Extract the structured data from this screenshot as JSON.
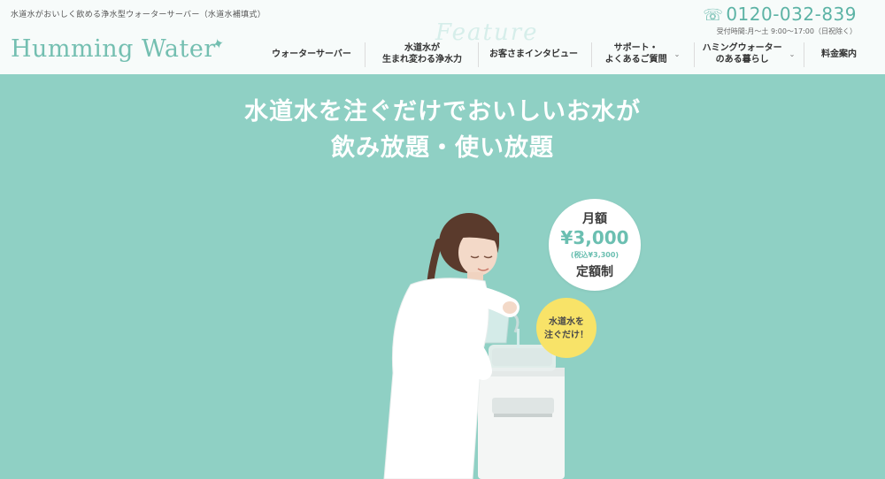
{
  "header": {
    "tagline": "水道水がおいしく飲める浄水型ウォーターサーバー（水道水補填式）",
    "logo": "Humming Water",
    "feature_word": "Feature",
    "phone": "0120-032-839",
    "hours": "受付時間:月〜土 9:00〜17:00（日祝除く）"
  },
  "nav": {
    "items": [
      {
        "line1": "ウォーターサーバー",
        "line2": ""
      },
      {
        "line1": "水道水が",
        "line2": "生まれ変わる浄水力"
      },
      {
        "line1": "お客さまインタビュー",
        "line2": ""
      },
      {
        "line1": "サポート・",
        "line2": "よくあるご質問"
      },
      {
        "line1": "ハミングウォーター",
        "line2": "のある暮らし"
      },
      {
        "line1": "料金案内",
        "line2": ""
      }
    ]
  },
  "hero": {
    "headline1": "水道水を注ぐだけでおいしいお水が",
    "headline2": "飲み放題・使い放題",
    "price_badge": {
      "label_top": "月額",
      "price": "¥3,000",
      "tax": "(税込¥3,300)",
      "label_bottom": "定額制"
    },
    "pour_badge": {
      "line1": "水道水を",
      "line2": "注ぐだけ！"
    }
  },
  "icons": {
    "phone": "phone-icon",
    "logo_mark": "bird-icon",
    "dropdown": "chevron-down-icon"
  },
  "colors": {
    "brand": "#74bfb1",
    "hero_bg": "#8fd0c4",
    "header_bg": "#f7fbfa",
    "badge_yellow": "#f8e368"
  }
}
